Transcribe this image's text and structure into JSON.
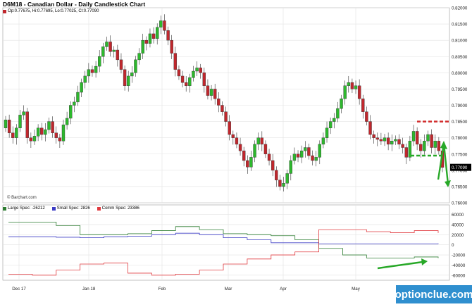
{
  "title": "D6M18 - Canadian Dollar - Daily Candlestick Chart",
  "ohlc": "Op:0.77675, Hi:0.77695, Lo:0.77025, Cl:0.77090",
  "watermark": "© Barchart.com",
  "brand": "optionclue.com",
  "colors": {
    "up": "#2db82d",
    "down": "#c0272d",
    "large": "#2e7d32",
    "small": "#3b3bc4",
    "comm": "#e0393e",
    "arrow": "#27a827",
    "level": "#d32f2f",
    "level_green": "#27a827"
  },
  "chart_data": [
    {
      "type": "candlestick",
      "title": "D6M18 - Canadian Dollar - Daily Candlestick Chart",
      "x_ticks": [
        "Dec 17",
        "Jan 18",
        "Feb",
        "Mar",
        "Apr",
        "May"
      ],
      "y_ticks": [
        "0.82000",
        "0.81500",
        "0.81000",
        "0.80500",
        "0.80000",
        "0.79500",
        "0.79000",
        "0.78500",
        "0.78000",
        "0.77500",
        "0.77000",
        "0.76500",
        "0.76000"
      ],
      "ylim": [
        0.76,
        0.82
      ],
      "last_price": "0.77090",
      "closes": [
        0.7855,
        0.7815,
        0.78,
        0.783,
        0.787,
        0.788,
        0.78,
        0.779,
        0.7805,
        0.783,
        0.781,
        0.7825,
        0.785,
        0.7815,
        0.78,
        0.779,
        0.784,
        0.786,
        0.79,
        0.791,
        0.794,
        0.797,
        0.799,
        0.801,
        0.8,
        0.802,
        0.805,
        0.808,
        0.8095,
        0.8065,
        0.807,
        0.804,
        0.801,
        0.796,
        0.799,
        0.8,
        0.804,
        0.806,
        0.81,
        0.809,
        0.812,
        0.8105,
        0.814,
        0.816,
        0.813,
        0.81,
        0.806,
        0.801,
        0.799,
        0.797,
        0.796,
        0.7985,
        0.8005,
        0.8015,
        0.8,
        0.796,
        0.793,
        0.795,
        0.792,
        0.79,
        0.788,
        0.785,
        0.781,
        0.78,
        0.778,
        0.776,
        0.773,
        0.771,
        0.774,
        0.778,
        0.78,
        0.778,
        0.775,
        0.773,
        0.77,
        0.767,
        0.765,
        0.766,
        0.769,
        0.773,
        0.775,
        0.774,
        0.776,
        0.777,
        0.7745,
        0.773,
        0.774,
        0.778,
        0.78,
        0.783,
        0.785,
        0.786,
        0.789,
        0.792,
        0.796,
        0.797,
        0.795,
        0.796,
        0.792,
        0.788,
        0.785,
        0.781,
        0.78,
        0.7795,
        0.779,
        0.78,
        0.778,
        0.779,
        0.7795,
        0.778,
        0.777,
        0.774,
        0.779,
        0.782,
        0.778,
        0.776,
        0.779,
        0.781,
        0.777,
        0.779,
        0.776,
        0.7709
      ],
      "levels": {
        "red_dashed": 0.785,
        "green_dashed": 0.7745
      }
    },
    {
      "type": "line",
      "title": "",
      "x_ticks": [
        "Dec 17",
        "Jan 18",
        "Feb",
        "Mar",
        "Apr",
        "May"
      ],
      "y_ticks": [
        "60000",
        "40000",
        "20000",
        "0",
        "-20000",
        "-40000",
        "-60000"
      ],
      "ylim": [
        -70000,
        65000
      ],
      "series": [
        {
          "name": "Large Spec: -26212",
          "values": [
            45000,
            45000,
            38000,
            20000,
            20000,
            22000,
            28000,
            36000,
            30000,
            22000,
            20000,
            18000,
            10000,
            -7000,
            -20000,
            -26000,
            -26000,
            -24000,
            -26212
          ]
        },
        {
          "name": "Small Spec: 2826",
          "values": [
            16000,
            16000,
            15000,
            14000,
            16000,
            17000,
            20000,
            23000,
            20000,
            14000,
            10000,
            4000,
            4000,
            2000,
            2000,
            2000,
            2000,
            2000,
            2826
          ]
        },
        {
          "name": "Comm Spec: 23386",
          "values": [
            -58000,
            -60000,
            -50000,
            -38000,
            -36000,
            -56000,
            -60000,
            -58000,
            -50000,
            -38000,
            -28000,
            -20000,
            -14000,
            30000,
            30000,
            26000,
            24000,
            28000,
            23386
          ]
        }
      ]
    }
  ]
}
